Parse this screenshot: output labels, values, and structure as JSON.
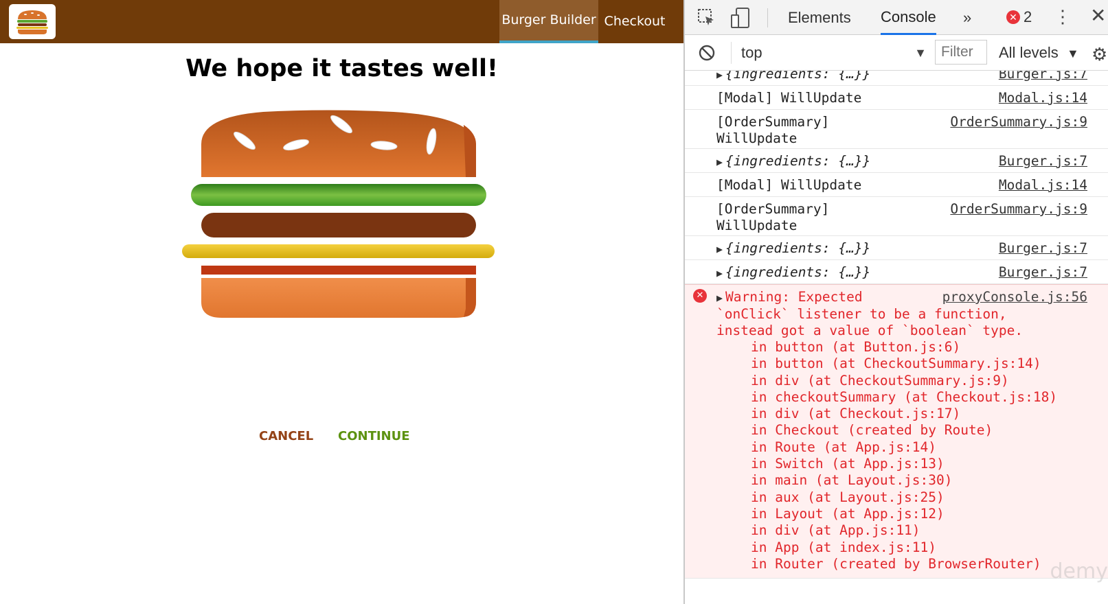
{
  "app": {
    "nav": {
      "burger_builder": "Burger Builder",
      "checkout": "Checkout"
    },
    "headline": "We hope it tastes well!",
    "buttons": {
      "cancel": "CANCEL",
      "continue": "CONTINUE"
    },
    "colors": {
      "toolbar": "#703B09",
      "active_nav": "#8F5C2C",
      "cancel": "#944317",
      "continue": "#5C9210"
    }
  },
  "devtools": {
    "tabs": {
      "elements": "Elements",
      "console": "Console",
      "more": "»"
    },
    "error_count": "2",
    "context": "top",
    "filter_placeholder": "Filter",
    "levels": "All levels",
    "rows": [
      {
        "text": "{ingredients: {…}}",
        "source": "Burger.js:7"
      },
      {
        "text": "[Modal] WillUpdate",
        "source": "Modal.js:14"
      },
      {
        "text": "[OrderSummary]\nWillUpdate",
        "source": "OrderSummary.js:9"
      },
      {
        "text": "{ingredients: {…}}",
        "source": "Burger.js:7"
      },
      {
        "text": "[Modal] WillUpdate",
        "source": "Modal.js:14"
      },
      {
        "text": "[OrderSummary]\nWillUpdate",
        "source": "OrderSummary.js:9"
      },
      {
        "text": "{ingredients: {…}}",
        "source": "Burger.js:7"
      },
      {
        "text": "{ingredients: {…}}",
        "source": "Burger.js:7"
      }
    ],
    "error": {
      "message": "Warning: Expected\n`onClick` listener to be a function,\ninstead got a value of `boolean` type.",
      "source": "proxyConsole.js:56",
      "stack": [
        "in button (at Button.js:6)",
        "in button (at CheckoutSummary.js:14)",
        "in div (at CheckoutSummary.js:9)",
        "in checkoutSummary (at Checkout.js:18)",
        "in div (at Checkout.js:17)",
        "in Checkout (created by Route)",
        "in Route (at App.js:14)",
        "in Switch (at App.js:13)",
        "in main (at Layout.js:30)",
        "in aux (at Layout.js:25)",
        "in Layout (at App.js:12)",
        "in div (at App.js:11)",
        "in App (at index.js:11)",
        "in Router (created by BrowserRouter)"
      ]
    }
  }
}
